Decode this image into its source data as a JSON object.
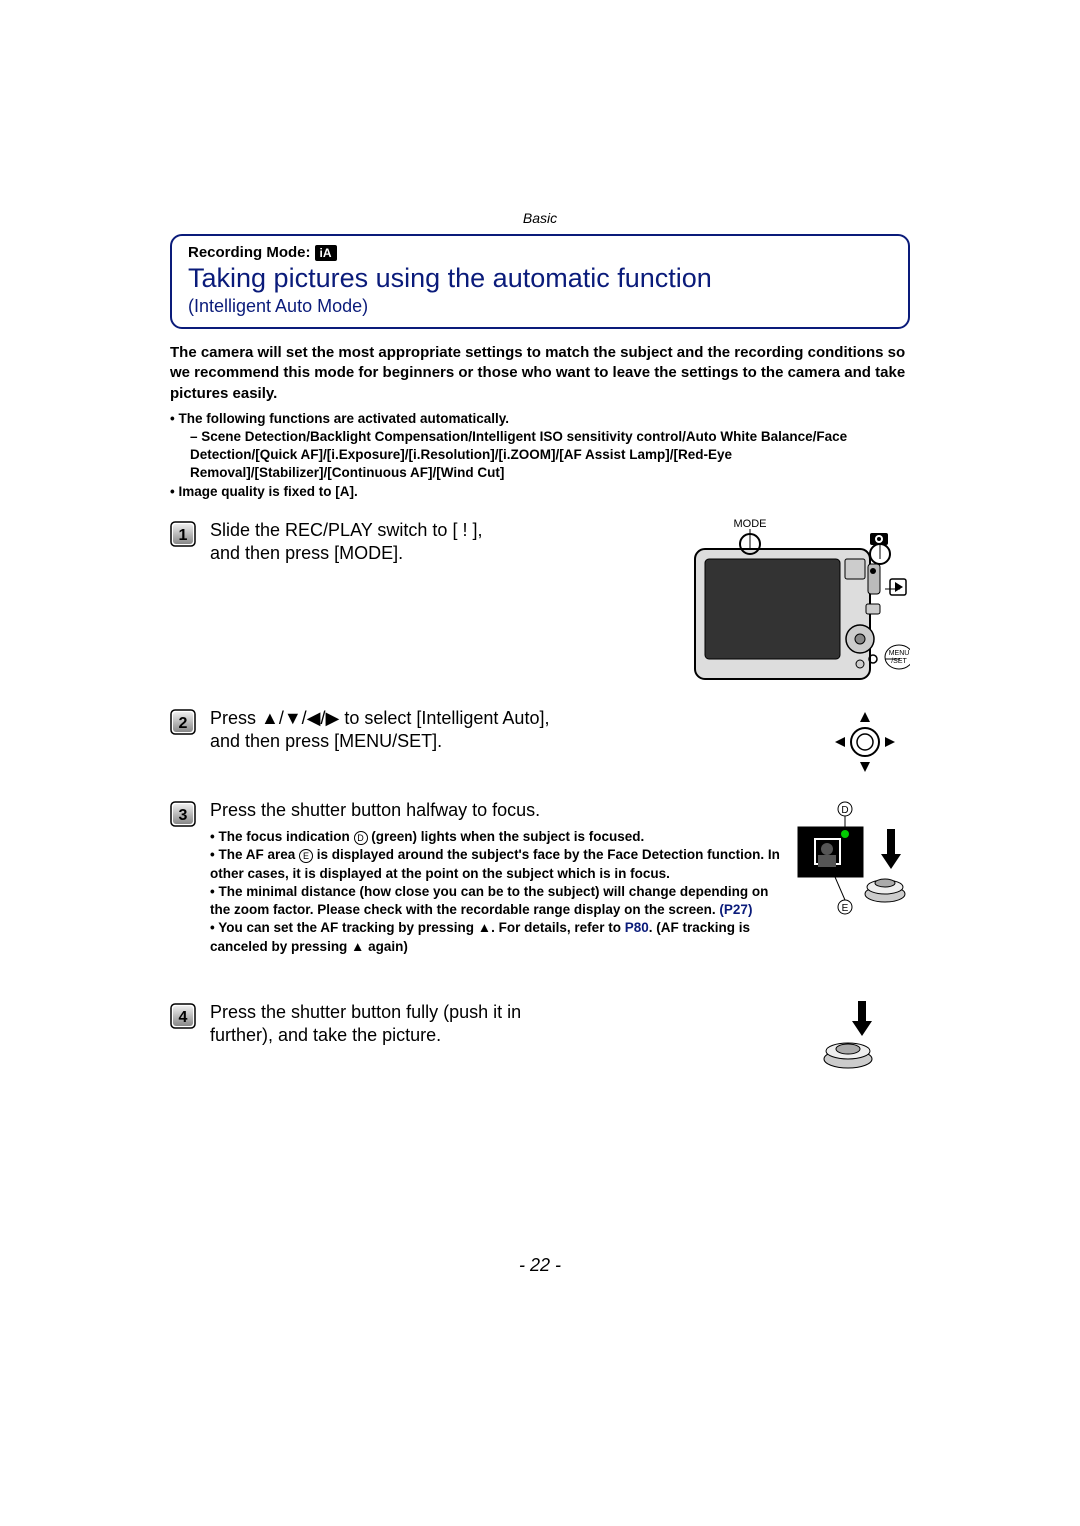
{
  "section_header": "Basic",
  "recording_mode_label": "Recording Mode:",
  "icon_text": "iA",
  "title_main": "Taking pictures using the automatic function",
  "title_sub": "(Intelligent Auto Mode)",
  "intro": "The camera will set the most appropriate settings to match the subject and the recording conditions so we recommend this mode for beginners or those who want to leave the settings to the camera and take pictures easily.",
  "bullet_auto": "The following functions are activated automatically.",
  "bullet_auto_sub": "Scene Detection/Backlight Compensation/Intelligent ISO sensitivity control/Auto White Balance/Face Detection/[Quick AF]/[i.Exposure]/[i.Resolution]/[i.ZOOM]/[AF Assist Lamp]/[Red-Eye Removal]/[Stabilizer]/[Continuous AF]/[Wind Cut]",
  "bullet_quality": "Image quality is fixed to [A].",
  "steps": {
    "s1": {
      "line1": "Slide the REC/PLAY switch to [ ! ],",
      "line2": "and then press [MODE]."
    },
    "s2": {
      "line1": "Press ▲/▼/◀/▶ to select [Intelligent Auto],",
      "line2": "and then press [MENU/SET]."
    },
    "s3": {
      "main": "Press the shutter button halfway to focus.",
      "n1a": "The focus indication ",
      "n1b": " (green) lights when the subject is focused.",
      "n2a": "The AF area ",
      "n2b": " is displayed around the subject's face by the Face Detection function. In other cases, it is displayed at the point on the subject which is in focus.",
      "n3a": "The minimal distance (how close you can be to the subject) will change depending on the zoom factor. Please check with the recordable range display on the screen. ",
      "n3ref": "(P27)",
      "n4a": "You can set the AF tracking by pressing ▲. For details, refer to ",
      "n4ref": "P80",
      "n4b": ". (AF tracking is canceled by pressing ▲ again)",
      "label_d": "D",
      "label_e": "E"
    },
    "s4": {
      "line1": "Press the shutter button fully (push it in",
      "line2": "further), and take the picture."
    }
  },
  "camera_labels": {
    "mode": "MODE",
    "menuset": "MENU\n/SET"
  },
  "page_number": "- 22 -"
}
